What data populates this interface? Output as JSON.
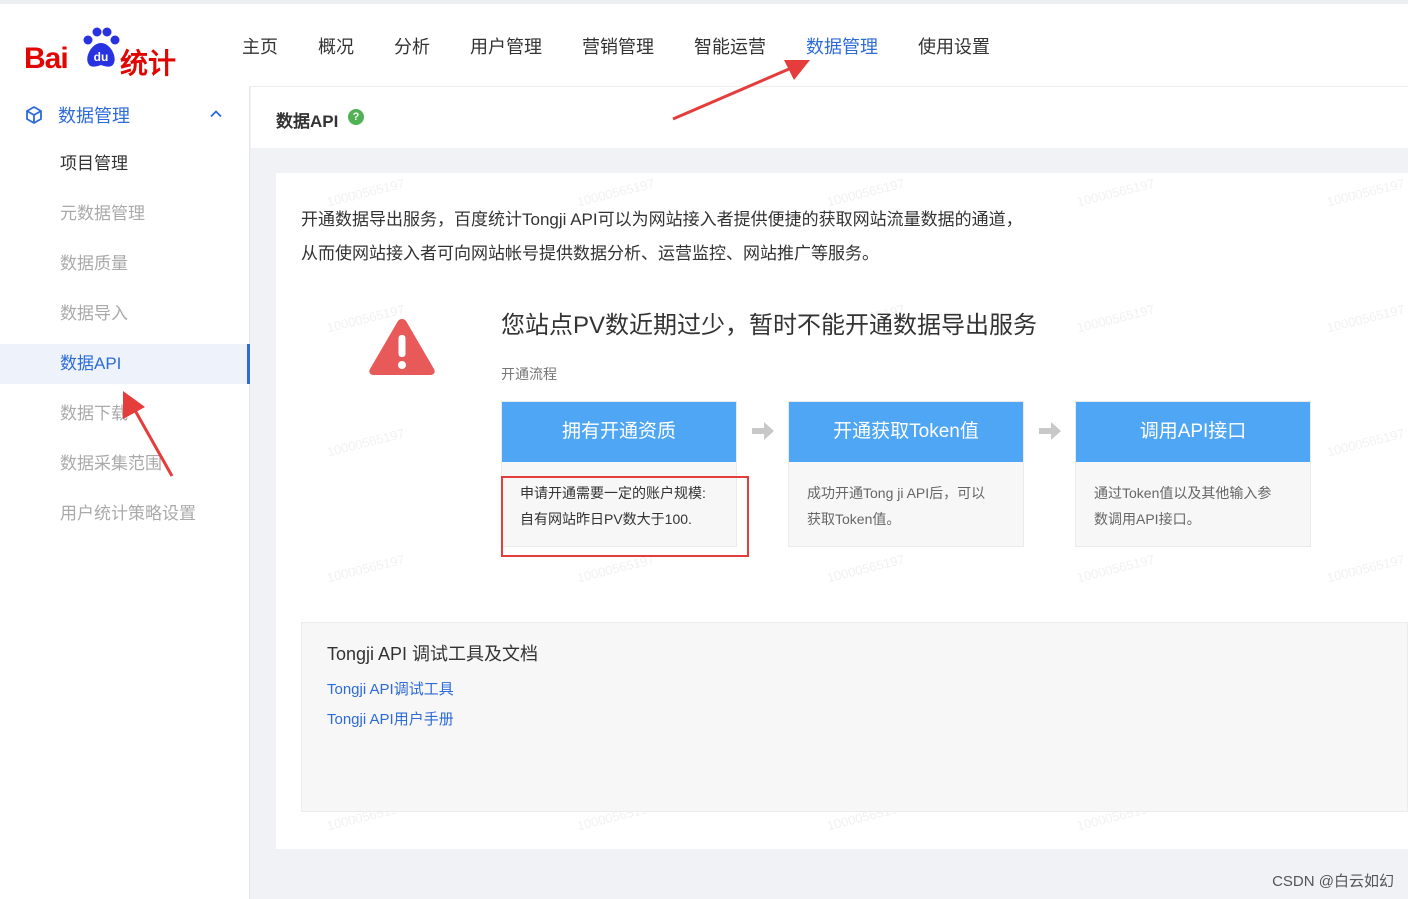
{
  "brand": {
    "logo_text_left": "Bai",
    "logo_text_paw": "du",
    "logo_text_right": "统计"
  },
  "nav": {
    "items": [
      "主页",
      "概况",
      "分析",
      "用户管理",
      "营销管理",
      "智能运营",
      "数据管理",
      "使用设置"
    ],
    "active_index": 6
  },
  "sidebar": {
    "group_label": "数据管理",
    "items": [
      "项目管理",
      "元数据管理",
      "数据质量",
      "数据导入",
      "数据API",
      "数据下载",
      "数据采集范围",
      "用户统计策略设置"
    ],
    "active_index": 4
  },
  "page": {
    "title": "数据API",
    "help_icon": "question-icon"
  },
  "intro": {
    "line1": "开通数据导出服务，百度统计Tongji API可以为网站接入者提供便捷的获取网站流量数据的通道，",
    "line2": "从而使网站接入者可向网站帐号提供数据分析、运营监控、网站推广等服务。"
  },
  "warning": {
    "title": "您站点PV数近期过少，暂时不能开通数据导出服务",
    "flow_label": "开通流程"
  },
  "steps": [
    {
      "title": "拥有开通资质",
      "line1": "申请开通需要一定的账户规模:",
      "line2": "自有网站昨日PV数大于100."
    },
    {
      "title": "开通获取Token值",
      "line1": "成功开通Tong ji API后，可以",
      "line2": "获取Token值。"
    },
    {
      "title": "调用API接口",
      "line1": "通过Token值以及其他输入参",
      "line2": "数调用API接口。"
    }
  ],
  "docs": {
    "title": "Tongji API 调试工具及文档",
    "link1": "Tongji API调试工具",
    "link2": "Tongji API用户手册"
  },
  "watermark": "10000565197",
  "credit": "CSDN @白云如幻",
  "colors": {
    "accent": "#2d6bd8",
    "step_blue": "#4fa6f5",
    "brand_red": "#e10602",
    "annotation_red": "#e53c3c",
    "warning_red": "#e85a5a"
  }
}
